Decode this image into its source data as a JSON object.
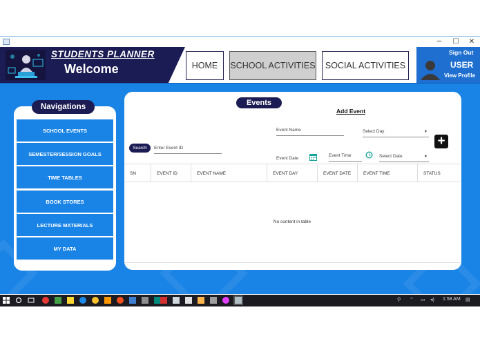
{
  "window": {
    "minimize": "─",
    "maximize": "☐",
    "close": "✕"
  },
  "brand": {
    "title": "STUDENTS PLANNER",
    "welcome": "Welcome"
  },
  "nav_tabs": [
    {
      "label": "HOME"
    },
    {
      "label": "SCHOOL ACTIVITIES",
      "active": true
    },
    {
      "label": "SOCIAL ACTIVITIES"
    }
  ],
  "user": {
    "sign_out": "Sign Out",
    "name": "USER",
    "view_profile": "View Profile"
  },
  "navigation": {
    "title": "Navigations",
    "items": [
      {
        "label": "SCHOOL EVENTS"
      },
      {
        "label": "SEMESTER/SESSION GOALS"
      },
      {
        "label": "TIME TABLES"
      },
      {
        "label": "BOOK STORES"
      },
      {
        "label": "LECTURE MATERIALS"
      },
      {
        "label": "MY DATA"
      }
    ]
  },
  "events": {
    "title": "Events",
    "add_event": "Add Event",
    "event_name_placeholder": "Event Name",
    "select_day_placeholder": "Select Day",
    "search_button": "Search",
    "event_id_placeholder": "Enter Event ID",
    "event_date_placeholder": "Event Date",
    "event_time_placeholder": "Event Time",
    "select_date_placeholder": "Select Date",
    "add_button": "+",
    "columns": [
      "SN",
      "EVENT ID",
      "EVENT NAME",
      "EVENT DAY",
      "EVENT DATE",
      "EVENT TIME",
      "STATUS"
    ],
    "empty_message": "No content in table"
  },
  "taskbar": {
    "time": "1:58 AM"
  },
  "colors": {
    "navy": "#1c1c55",
    "accent_blue": "#1a84e6",
    "user_blue": "#1f6fd1"
  }
}
